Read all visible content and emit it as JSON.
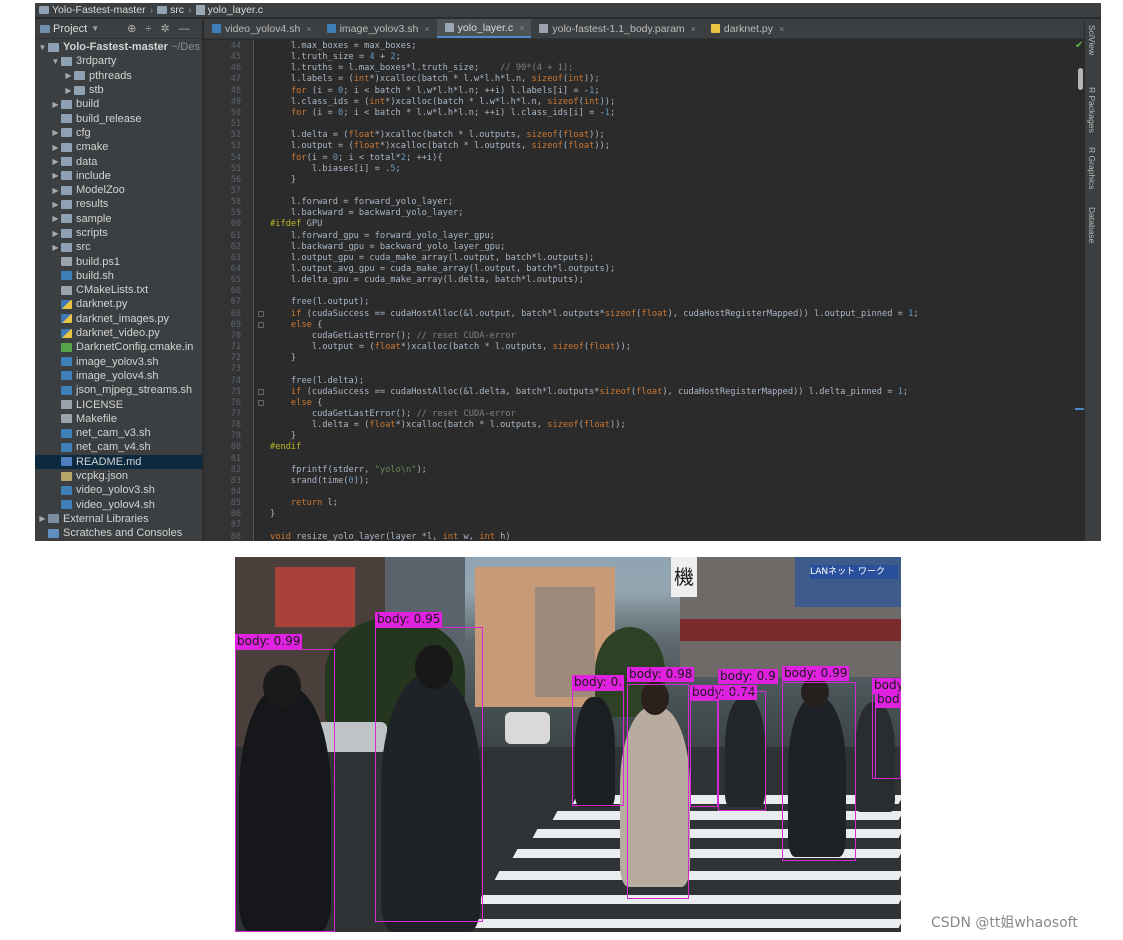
{
  "ide": {
    "breadcrumbs": [
      "Yolo-Fastest-master",
      "src",
      "yolo_layer.c"
    ],
    "project_panel": {
      "title": "Project",
      "dropdown_icon": "chevron-down-icon",
      "tools": [
        "⊕",
        "÷",
        "✲",
        "—"
      ],
      "tree": [
        {
          "label": "Yolo-Fastest-master",
          "suffix": "~/Des",
          "indent": 0,
          "arrow": "▼",
          "icon": "folder-open"
        },
        {
          "label": "3rdparty",
          "indent": 1,
          "arrow": "▼",
          "icon": "folder-open"
        },
        {
          "label": "pthreads",
          "indent": 2,
          "arrow": "▶",
          "icon": "folder"
        },
        {
          "label": "stb",
          "indent": 2,
          "arrow": "▶",
          "icon": "folder"
        },
        {
          "label": "build",
          "indent": 1,
          "arrow": "▶",
          "icon": "folder"
        },
        {
          "label": "build_release",
          "indent": 1,
          "arrow": "",
          "icon": "folder"
        },
        {
          "label": "cfg",
          "indent": 1,
          "arrow": "▶",
          "icon": "folder"
        },
        {
          "label": "cmake",
          "indent": 1,
          "arrow": "▶",
          "icon": "folder"
        },
        {
          "label": "data",
          "indent": 1,
          "arrow": "▶",
          "icon": "folder"
        },
        {
          "label": "include",
          "indent": 1,
          "arrow": "▶",
          "icon": "folder"
        },
        {
          "label": "ModelZoo",
          "indent": 1,
          "arrow": "▶",
          "icon": "folder"
        },
        {
          "label": "results",
          "indent": 1,
          "arrow": "▶",
          "icon": "folder"
        },
        {
          "label": "sample",
          "indent": 1,
          "arrow": "▶",
          "icon": "folder"
        },
        {
          "label": "scripts",
          "indent": 1,
          "arrow": "▶",
          "icon": "folder"
        },
        {
          "label": "src",
          "indent": 1,
          "arrow": "▶",
          "icon": "folder"
        },
        {
          "label": "build.ps1",
          "indent": 1,
          "arrow": "",
          "icon": "txt"
        },
        {
          "label": "build.sh",
          "indent": 1,
          "arrow": "",
          "icon": "sh"
        },
        {
          "label": "CMakeLists.txt",
          "indent": 1,
          "arrow": "",
          "icon": "txt"
        },
        {
          "label": "darknet.py",
          "indent": 1,
          "arrow": "",
          "icon": "py"
        },
        {
          "label": "darknet_images.py",
          "indent": 1,
          "arrow": "",
          "icon": "py"
        },
        {
          "label": "darknet_video.py",
          "indent": 1,
          "arrow": "",
          "icon": "py"
        },
        {
          "label": "DarknetConfig.cmake.in",
          "indent": 1,
          "arrow": "",
          "icon": "cmake"
        },
        {
          "label": "image_yolov3.sh",
          "indent": 1,
          "arrow": "",
          "icon": "sh"
        },
        {
          "label": "image_yolov4.sh",
          "indent": 1,
          "arrow": "",
          "icon": "sh"
        },
        {
          "label": "json_mjpeg_streams.sh",
          "indent": 1,
          "arrow": "",
          "icon": "sh"
        },
        {
          "label": "LICENSE",
          "indent": 1,
          "arrow": "",
          "icon": "txt"
        },
        {
          "label": "Makefile",
          "indent": 1,
          "arrow": "",
          "icon": "txt"
        },
        {
          "label": "net_cam_v3.sh",
          "indent": 1,
          "arrow": "",
          "icon": "sh"
        },
        {
          "label": "net_cam_v4.sh",
          "indent": 1,
          "arrow": "",
          "icon": "sh"
        },
        {
          "label": "README.md",
          "indent": 1,
          "arrow": "",
          "icon": "md",
          "selected": true
        },
        {
          "label": "vcpkg.json",
          "indent": 1,
          "arrow": "",
          "icon": "json"
        },
        {
          "label": "video_yolov3.sh",
          "indent": 1,
          "arrow": "",
          "icon": "sh"
        },
        {
          "label": "video_yolov4.sh",
          "indent": 1,
          "arrow": "",
          "icon": "sh"
        },
        {
          "label": "External Libraries",
          "indent": 0,
          "arrow": "▶",
          "icon": "lib"
        },
        {
          "label": "Scratches and Consoles",
          "indent": 0,
          "arrow": "",
          "icon": "scratch"
        }
      ]
    },
    "tabs": [
      {
        "label": "video_yolov4.sh",
        "icon": "sh",
        "active": false
      },
      {
        "label": "image_yolov3.sh",
        "icon": "sh",
        "active": false
      },
      {
        "label": "yolo_layer.c",
        "icon": "c",
        "active": true
      },
      {
        "label": "yolo-fastest-1.1_body.param",
        "icon": "txt",
        "active": false
      },
      {
        "label": "darknet.py",
        "icon": "py",
        "active": false
      }
    ],
    "right_tools": [
      "SciView",
      "R Packages",
      "R Graphics",
      "Database"
    ],
    "first_line_number": 44,
    "code_lines": [
      [
        [
          "    l.max_boxes = max_boxes;",
          ""
        ]
      ],
      [
        [
          "    l.truth_size = ",
          ""
        ],
        [
          "4",
          "nm"
        ],
        [
          " + ",
          ""
        ],
        [
          "2",
          "nm"
        ],
        [
          ";",
          ""
        ]
      ],
      [
        [
          "    l.truths = l.max_boxes*l.truth_size;    ",
          ""
        ],
        [
          "// 90*(4 + 1);",
          "cm"
        ]
      ],
      [
        [
          "    l.labels = (",
          ""
        ],
        [
          "int",
          "kw"
        ],
        [
          "*)xcalloc(batch * l.w*l.h*l.n, ",
          ""
        ],
        [
          "sizeof",
          "kw"
        ],
        [
          "(",
          ""
        ],
        [
          "int",
          "kw"
        ],
        [
          "));",
          ""
        ]
      ],
      [
        [
          "    ",
          ""
        ],
        [
          "for",
          "kw"
        ],
        [
          " (i = ",
          ""
        ],
        [
          "0",
          "nm"
        ],
        [
          "; i < batch * l.w*l.h*l.n; ++i) l.labels[i] = -",
          ""
        ],
        [
          "1",
          "nm"
        ],
        [
          ";",
          ""
        ]
      ],
      [
        [
          "    l.class_ids = (",
          ""
        ],
        [
          "int",
          "kw"
        ],
        [
          "*)xcalloc(batch * l.w*l.h*l.n, ",
          ""
        ],
        [
          "sizeof",
          "kw"
        ],
        [
          "(",
          ""
        ],
        [
          "int",
          "kw"
        ],
        [
          "));",
          ""
        ]
      ],
      [
        [
          "    ",
          ""
        ],
        [
          "for",
          "kw"
        ],
        [
          " (i = ",
          ""
        ],
        [
          "0",
          "nm"
        ],
        [
          "; i < batch * l.w*l.h*l.n; ++i) l.class_ids[i] = -",
          ""
        ],
        [
          "1",
          "nm"
        ],
        [
          ";",
          ""
        ]
      ],
      [
        [
          "",
          ""
        ]
      ],
      [
        [
          "    l.delta = (",
          ""
        ],
        [
          "float",
          "kw"
        ],
        [
          "*)xcalloc(batch * l.outputs, ",
          ""
        ],
        [
          "sizeof",
          "kw"
        ],
        [
          "(",
          ""
        ],
        [
          "float",
          "kw"
        ],
        [
          "));",
          ""
        ]
      ],
      [
        [
          "    l.output = (",
          ""
        ],
        [
          "float",
          "kw"
        ],
        [
          "*)xcalloc(batch * l.outputs, ",
          ""
        ],
        [
          "sizeof",
          "kw"
        ],
        [
          "(",
          ""
        ],
        [
          "float",
          "kw"
        ],
        [
          "));",
          ""
        ]
      ],
      [
        [
          "    ",
          ""
        ],
        [
          "for",
          "kw"
        ],
        [
          "(i = ",
          ""
        ],
        [
          "0",
          "nm"
        ],
        [
          "; i < total*",
          ""
        ],
        [
          "2",
          "nm"
        ],
        [
          "; ++i){",
          ""
        ]
      ],
      [
        [
          "        l.biases[i] = .",
          ""
        ],
        [
          "5",
          "nm"
        ],
        [
          ";",
          ""
        ]
      ],
      [
        [
          "    }",
          ""
        ]
      ],
      [
        [
          "",
          ""
        ]
      ],
      [
        [
          "    l.forward = forward_yolo_layer;",
          ""
        ]
      ],
      [
        [
          "    l.backward = backward_yolo_layer;",
          ""
        ]
      ],
      [
        [
          "#ifdef",
          "pp"
        ],
        [
          " GPU",
          ""
        ]
      ],
      [
        [
          "    l.forward_gpu = forward_yolo_layer_gpu;",
          ""
        ]
      ],
      [
        [
          "    l.backward_gpu = backward_yolo_layer_gpu;",
          ""
        ]
      ],
      [
        [
          "    l.output_gpu = cuda_make_array(l.output, batch*l.outputs);",
          ""
        ]
      ],
      [
        [
          "    l.output_avg_gpu = cuda_make_array(l.output, batch*l.outputs);",
          ""
        ]
      ],
      [
        [
          "    l.delta_gpu = cuda_make_array(l.delta, batch*l.outputs);",
          ""
        ]
      ],
      [
        [
          "",
          ""
        ]
      ],
      [
        [
          "    free(l.output);",
          ""
        ]
      ],
      [
        [
          "    ",
          ""
        ],
        [
          "if",
          "kw"
        ],
        [
          " (cudaSuccess == cudaHostAlloc(&l.output, batch*l.outputs*",
          ""
        ],
        [
          "sizeof",
          "kw"
        ],
        [
          "(",
          ""
        ],
        [
          "float",
          "kw"
        ],
        [
          "), cudaHostRegisterMapped)) l.output_pinned = ",
          ""
        ],
        [
          "1",
          "nm"
        ],
        [
          ";",
          ""
        ]
      ],
      [
        [
          "    ",
          ""
        ],
        [
          "else",
          "kw"
        ],
        [
          " {",
          ""
        ]
      ],
      [
        [
          "        cudaGetLastError(); ",
          ""
        ],
        [
          "// reset CUDA-error",
          "cm"
        ]
      ],
      [
        [
          "        l.output = (",
          ""
        ],
        [
          "float",
          "kw"
        ],
        [
          "*)xcalloc(batch * l.outputs, ",
          ""
        ],
        [
          "sizeof",
          "kw"
        ],
        [
          "(",
          ""
        ],
        [
          "float",
          "kw"
        ],
        [
          "));",
          ""
        ]
      ],
      [
        [
          "    }",
          ""
        ]
      ],
      [
        [
          "",
          ""
        ]
      ],
      [
        [
          "    free(l.delta);",
          ""
        ]
      ],
      [
        [
          "    ",
          ""
        ],
        [
          "if",
          "kw"
        ],
        [
          " (cudaSuccess == cudaHostAlloc(&l.delta, batch*l.outputs*",
          ""
        ],
        [
          "sizeof",
          "kw"
        ],
        [
          "(",
          ""
        ],
        [
          "float",
          "kw"
        ],
        [
          "), cudaHostRegisterMapped)) l.delta_pinned = ",
          ""
        ],
        [
          "1",
          "nm"
        ],
        [
          ";",
          ""
        ]
      ],
      [
        [
          "    ",
          ""
        ],
        [
          "else",
          "kw"
        ],
        [
          " {",
          ""
        ]
      ],
      [
        [
          "        cudaGetLastError(); ",
          ""
        ],
        [
          "// reset CUDA-error",
          "cm"
        ]
      ],
      [
        [
          "        l.delta = (",
          ""
        ],
        [
          "float",
          "kw"
        ],
        [
          "*)xcalloc(batch * l.outputs, ",
          ""
        ],
        [
          "sizeof",
          "kw"
        ],
        [
          "(",
          ""
        ],
        [
          "float",
          "kw"
        ],
        [
          "));",
          ""
        ]
      ],
      [
        [
          "    }",
          ""
        ]
      ],
      [
        [
          "#endif",
          "pp"
        ]
      ],
      [
        [
          "",
          ""
        ]
      ],
      [
        [
          "    fprintf(stderr, ",
          ""
        ],
        [
          "\"yolo\\n\"",
          "st"
        ],
        [
          ");",
          ""
        ]
      ],
      [
        [
          "    srand(time(",
          ""
        ],
        [
          "0",
          "nm"
        ],
        [
          "));",
          ""
        ]
      ],
      [
        [
          "",
          ""
        ]
      ],
      [
        [
          "    ",
          ""
        ],
        [
          "return",
          "kw"
        ],
        [
          " l;",
          ""
        ]
      ],
      [
        [
          "}",
          ""
        ]
      ],
      [
        [
          "",
          ""
        ]
      ],
      [
        [
          "void",
          "kw"
        ],
        [
          " resize_yolo_layer(layer *l, ",
          ""
        ],
        [
          "int",
          "kw"
        ],
        [
          " w, ",
          ""
        ],
        [
          "int",
          "kw"
        ],
        [
          " h)",
          ""
        ]
      ]
    ]
  },
  "photo": {
    "label_color": "#e022e0",
    "detections": [
      {
        "label": "body: 0.99"
      },
      {
        "label": "body: 0.95"
      },
      {
        "label": "body: 0."
      },
      {
        "label": "body: 0.98"
      },
      {
        "label": "body: 0.74"
      },
      {
        "label": "body: 0.9"
      },
      {
        "label": "body: 0.99"
      },
      {
        "label": "body"
      },
      {
        "label": "bod"
      }
    ],
    "signs": {
      "shop_left": "機",
      "shop_right": "LANネット ワーク"
    }
  },
  "watermark": "CSDN @tt姐whaosoft"
}
